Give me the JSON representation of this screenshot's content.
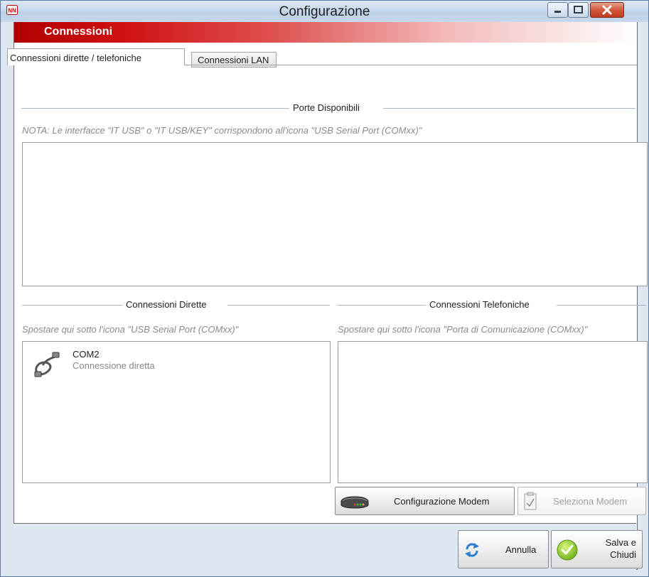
{
  "window": {
    "title": "Configurazione",
    "accent": "#c60000"
  },
  "section": {
    "title": "Connessioni"
  },
  "tabs": [
    {
      "label": "Connessioni dirette / telefoniche",
      "active": true
    },
    {
      "label": "Connessioni LAN",
      "active": false
    }
  ],
  "porte": {
    "title": "Porte Disponibili",
    "note": "NOTA: Le interfacce \"IT USB\" o \"IT USB/KEY\" corrispondono all'icona \"USB Serial Port (COMxx)\""
  },
  "dirette": {
    "title": "Connessioni Dirette",
    "hint": "Spostare qui sotto l'icona \"USB Serial Port (COMxx)\"",
    "items": [
      {
        "name": "COM2",
        "description": "Connessione diretta",
        "icon": "serial-cable-icon"
      }
    ]
  },
  "telefoniche": {
    "title": "Connessioni Telefoniche",
    "hint": "Spostare qui sotto l'icona \"Porta di Comunicazione (COMxx)\""
  },
  "buttons": {
    "configurazione_modem": "Configurazione Modem",
    "seleziona_modem": "Seleziona Modem",
    "annulla": "Annulla",
    "salva_line1": "Salva e",
    "salva_line2": "Chiudi"
  }
}
